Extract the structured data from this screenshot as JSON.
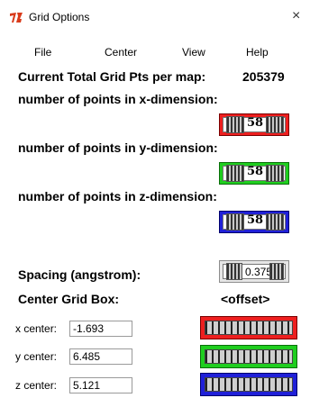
{
  "window": {
    "title": "Grid Options",
    "close_label": "×"
  },
  "menu": [
    "File",
    "Center",
    "View",
    "Help"
  ],
  "total": {
    "label": "Current Total Grid Pts per map:",
    "value": "205379"
  },
  "dims": [
    {
      "label": "number of points in x-dimension:",
      "value": "58",
      "color": "#ee1f1f"
    },
    {
      "label": "number of points in y-dimension:",
      "value": "58",
      "color": "#1fce1f"
    },
    {
      "label": "number of points in z-dimension:",
      "value": "58",
      "color": "#2020d8"
    }
  ],
  "spacing": {
    "label": "Spacing (angstrom):",
    "value": "0.375"
  },
  "center": {
    "label": "Center Grid Box:",
    "offset_label": "<offset>",
    "x": {
      "label": "x center:",
      "value": "-1.693"
    },
    "y": {
      "label": "y center:",
      "value": "6.485"
    },
    "z": {
      "label": "z center:",
      "value": "5.121"
    }
  }
}
